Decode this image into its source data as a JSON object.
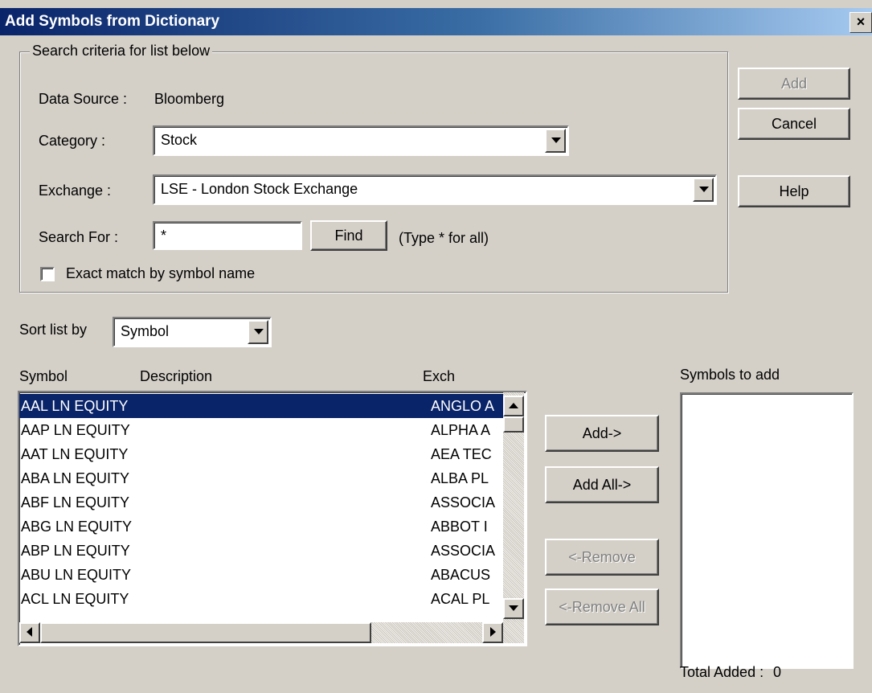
{
  "window": {
    "title": "Add Symbols from Dictionary",
    "close_glyph": "×"
  },
  "criteria": {
    "group_label": "Search criteria for list below",
    "data_source_label": "Data Source :",
    "data_source_value": "Bloomberg",
    "category_label": "Category :",
    "category_value": "Stock",
    "exchange_label": "Exchange :",
    "exchange_value": "LSE - London Stock Exchange",
    "search_label": "Search For :",
    "search_value": "*",
    "find_label": "Find",
    "hint": "(Type * for all)",
    "exact_match_label": "Exact match by symbol name",
    "exact_match_checked": false
  },
  "actions": {
    "add": "Add",
    "cancel": "Cancel",
    "help": "Help"
  },
  "sort": {
    "label": "Sort list by",
    "value": "Symbol"
  },
  "list": {
    "headers": {
      "symbol": "Symbol",
      "description": "Description",
      "exch": "Exch"
    },
    "rows": [
      {
        "symbol": "AAL LN EQUITY",
        "exch": "ANGLO A",
        "selected": true
      },
      {
        "symbol": "AAP LN EQUITY",
        "exch": "ALPHA A"
      },
      {
        "symbol": "AAT LN EQUITY",
        "exch": "AEA TEC"
      },
      {
        "symbol": "ABA LN EQUITY",
        "exch": "ALBA PL"
      },
      {
        "symbol": "ABF LN EQUITY",
        "exch": "ASSOCIA"
      },
      {
        "symbol": "ABG LN EQUITY",
        "exch": "ABBOT I"
      },
      {
        "symbol": "ABP LN EQUITY",
        "exch": "ASSOCIA"
      },
      {
        "symbol": "ABU LN EQUITY",
        "exch": "ABACUS"
      },
      {
        "symbol": "ACL LN EQUITY",
        "exch": "ACAL PL"
      }
    ]
  },
  "transfer": {
    "add": "Add->",
    "add_all": "Add All->",
    "remove": "<-Remove",
    "remove_all": "<-Remove All"
  },
  "symbols_to_add": {
    "label": "Symbols to add",
    "total_label": "Total Added :",
    "total_value": "0"
  },
  "colors": {
    "title_start": "#0a246a",
    "title_end": "#a6caf0",
    "selection": "#0a246a",
    "face": "#d4d0c8"
  }
}
